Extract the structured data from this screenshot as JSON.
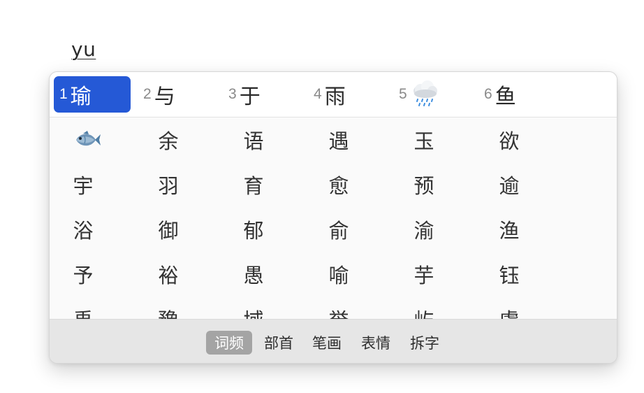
{
  "composition": {
    "text": "yu"
  },
  "candidates_top": [
    {
      "num": "1",
      "char": "瑜",
      "selected": true
    },
    {
      "num": "2",
      "char": "与"
    },
    {
      "num": "3",
      "char": "于"
    },
    {
      "num": "4",
      "char": "雨"
    },
    {
      "num": "5",
      "icon": "rain-cloud-icon"
    },
    {
      "num": "6",
      "char": "鱼"
    }
  ],
  "grid_rows": [
    [
      "fish-emoji-icon",
      "余",
      "语",
      "遇",
      "玉",
      "欲"
    ],
    [
      "宇",
      "羽",
      "育",
      "愈",
      "预",
      "逾"
    ],
    [
      "浴",
      "御",
      "郁",
      "俞",
      "渝",
      "渔"
    ],
    [
      "予",
      "裕",
      "愚",
      "喻",
      "芋",
      "钰"
    ],
    [
      "禹",
      "豫",
      "域",
      "誉",
      "屿",
      "虞"
    ]
  ],
  "footer_tabs": [
    {
      "label": "词频",
      "active": true
    },
    {
      "label": "部首"
    },
    {
      "label": "笔画"
    },
    {
      "label": "表情"
    },
    {
      "label": "拆字"
    }
  ],
  "colors": {
    "selection": "#2559d6",
    "active_tab": "#a4a4a4"
  }
}
